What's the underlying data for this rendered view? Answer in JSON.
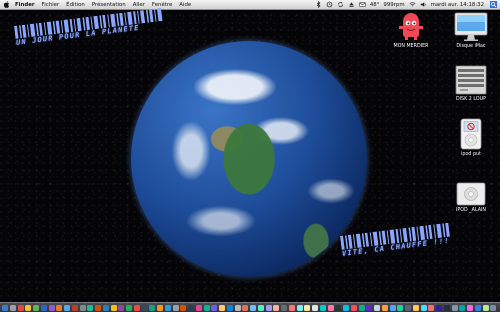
{
  "menubar": {
    "app_name": "Finder",
    "menus": [
      "Fichier",
      "Édition",
      "Présentation",
      "Aller",
      "Fenêtre",
      "Aide"
    ],
    "status": {
      "temperature": "48°",
      "speed": "999rpm",
      "datetime": "mardi aur.  14:18:32"
    }
  },
  "wallpaper": {
    "top_caption": "UN JOUR POUR LA PLANETE",
    "bottom_caption": "VITE, CA CHAUFFE !!!"
  },
  "desktop_icons": [
    {
      "label": "MON MERDIER",
      "icon": "pink-monster-folder-icon"
    },
    {
      "label": "Disque iMac",
      "icon": "imac-hard-disk-icon"
    },
    {
      "label": "DISK 2 LOUP",
      "icon": "external-disk-icon"
    },
    {
      "label": "ipod put",
      "icon": "ipod-icon"
    },
    {
      "label": "IPOD _ALAIN",
      "icon": "ipod-shuffle-icon"
    }
  ],
  "colors": {
    "caption": "#8aa6ff",
    "menubar": "#e6e6e6",
    "monster": "#ee4a55"
  },
  "dock": {
    "icon_colors": [
      "#3a7bd5",
      "#9aa0a8",
      "#e24a3b",
      "#f2c230",
      "#5fb35a",
      "#2e63c7",
      "#8a5bd1",
      "#e67e22",
      "#5aa9e6",
      "#c0392b",
      "#7f8c8d",
      "#1abc9c",
      "#d35400",
      "#2980b9",
      "#f1c40f",
      "#8e44ad",
      "#27ae60",
      "#e74c3c",
      "#34495e",
      "#16a085",
      "#f39c12",
      "#3498db",
      "#95a5a6",
      "#d35400",
      "#2c3e50",
      "#e84393",
      "#00b894",
      "#6c5ce7",
      "#fdcb6e",
      "#0984e3",
      "#b2bec3",
      "#e17055",
      "#74b9ff",
      "#55efc4",
      "#a29bfe",
      "#fab1a0",
      "#636e72",
      "#ff7675",
      "#81ecec",
      "#ffeaa7",
      "#dfe6e9",
      "#00cec9",
      "#fd79a8",
      "#2d3436",
      "#0abde3",
      "#ee5253",
      "#10ac84",
      "#5f27cd",
      "#c8d6e5",
      "#ff9f43",
      "#54a0ff",
      "#1dd1a1",
      "#576574",
      "#feca57",
      "#48dbfb",
      "#ff6b6b",
      "#341f97",
      "#222f3e",
      "#8395a7",
      "#01a3a4",
      "#f368e0",
      "#2e86de",
      "#b8e994",
      "#778ca3"
    ]
  }
}
